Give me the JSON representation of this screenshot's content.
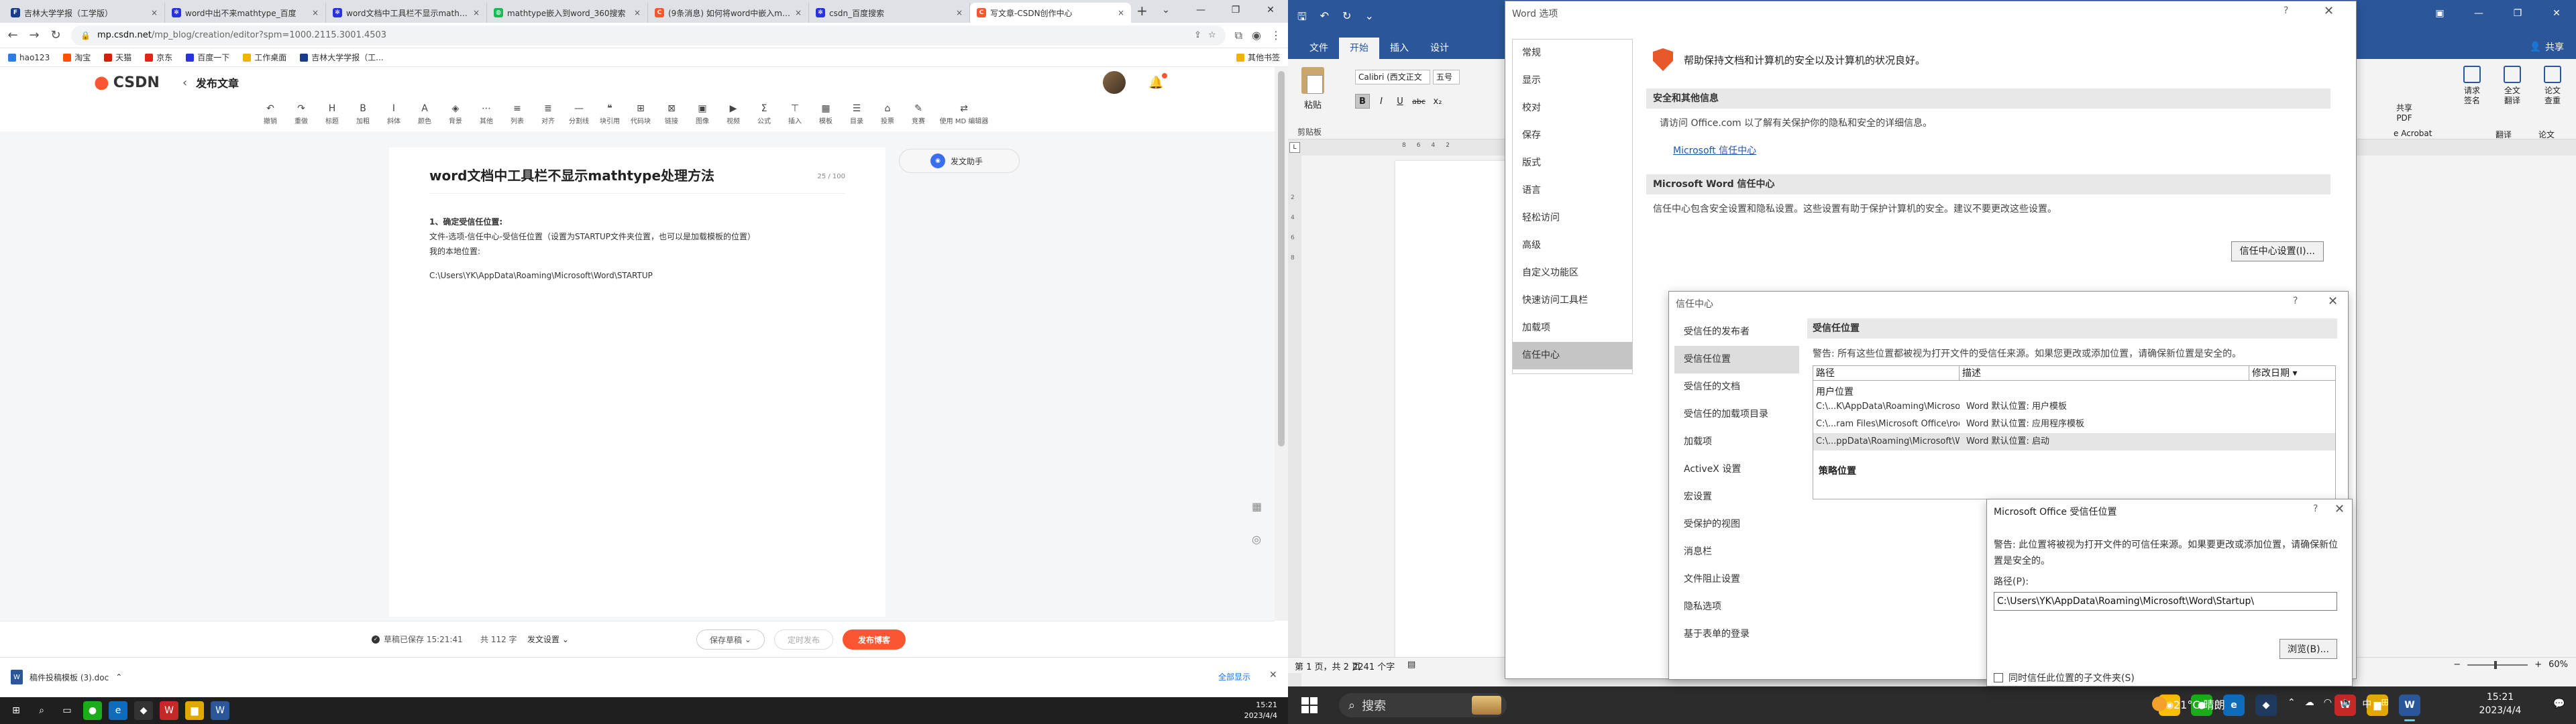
{
  "browser": {
    "tabs": [
      {
        "title": "吉林大学学报（工学版）",
        "color": "#1a3b8c",
        "glyph": "F"
      },
      {
        "title": "word中出不来mathtype_百度",
        "color": "#2932e1",
        "glyph": "✻"
      },
      {
        "title": "word文档中工具栏不显示mathtype",
        "color": "#2932e1",
        "glyph": "✻"
      },
      {
        "title": "mathtype嵌入到word_360搜索",
        "color": "#19b955",
        "glyph": "◍"
      },
      {
        "title": "(9条消息) 如何将word中嵌入mathtype",
        "color": "#fc5531",
        "glyph": "C"
      },
      {
        "title": "csdn_百度搜索",
        "color": "#2932e1",
        "glyph": "✻"
      },
      {
        "title": "写文章-CSDN创作中心",
        "color": "#fc5531",
        "glyph": "C"
      }
    ],
    "new_tab": "+",
    "url_host": "mp.csdn.net",
    "url_path": "/mp_blog/creation/editor?spm=1000.2115.3001.4503",
    "bookmarks": [
      "hao123",
      "淘宝",
      "天猫",
      "京东",
      "百度一下",
      "工作桌面",
      "吉林大学学报（工..."
    ],
    "other_bookmarks": "其他书签"
  },
  "csdn": {
    "logo": "CSDN",
    "header_title": "发布文章",
    "toolbar": [
      {
        "icon": "↶",
        "label": "撤销"
      },
      {
        "icon": "↷",
        "label": "重做"
      },
      {
        "icon": "H",
        "label": "标题"
      },
      {
        "icon": "B",
        "label": "加粗"
      },
      {
        "icon": "I",
        "label": "斜体"
      },
      {
        "icon": "A",
        "label": "颜色"
      },
      {
        "icon": "◈",
        "label": "背景"
      },
      {
        "icon": "⋯",
        "label": "其他"
      },
      {
        "icon": "≡",
        "label": "列表"
      },
      {
        "icon": "≣",
        "label": "对齐"
      },
      {
        "icon": "—",
        "label": "分割线"
      },
      {
        "icon": "❝",
        "label": "块引用"
      },
      {
        "icon": "⊞",
        "label": "代码块"
      },
      {
        "icon": "⊠",
        "label": "链接"
      },
      {
        "icon": "▣",
        "label": "图像"
      },
      {
        "icon": "▶",
        "label": "视频"
      },
      {
        "icon": "Σ",
        "label": "公式"
      },
      {
        "icon": "⊤",
        "label": "插入"
      },
      {
        "icon": "▦",
        "label": "模板"
      },
      {
        "icon": "☰",
        "label": "目录"
      },
      {
        "icon": "⌂",
        "label": "投票"
      },
      {
        "icon": "✎",
        "label": "竞赛"
      },
      {
        "icon": "⇄",
        "label": "使用 MD 编辑器"
      }
    ],
    "doc_title": "word文档中工具栏不显示mathtype处理方法",
    "word_count": "25 / 100",
    "body_heading": "1、确定受信任位置:",
    "body_line1": "文件-选项-信任中心-受信任位置（设置为STARTUP文件夹位置，也可以是加载模板的位置）",
    "body_line2": "我的本地位置:",
    "body_path": "C:\\Users\\YK\\AppData\\Roaming\\Microsoft\\Word\\STARTUP",
    "assistant_label": "发文助手",
    "draft_status": "草稿已保存 15:21:41",
    "total_words": "共 112 字",
    "article_settings": "发文设置",
    "save_draft": "保存草稿",
    "timed_publish": "定时发布",
    "publish": "发布博客"
  },
  "download": {
    "file": "稿件投稿模板 (3).doc",
    "show_all": "全部显示"
  },
  "left_taskbar": {
    "time": "15:21",
    "date": "2023/4/4"
  },
  "word": {
    "tabs": [
      "文件",
      "开始",
      "插入",
      "设计"
    ],
    "share": "共享",
    "paste": "粘贴",
    "clipboard": "剪贴板",
    "font": "Calibri (西文正文",
    "size": "五号",
    "fmt": [
      "B",
      "I",
      "U",
      "abc",
      "x₂"
    ],
    "acrobat_label": "共享\nPDF",
    "acrobat": "e Acrobat",
    "ribbon_right": [
      {
        "label": "请求\n签名"
      },
      {
        "label": "全文\n翻译"
      },
      {
        "label": "论文\n查重"
      }
    ],
    "ribbon_right_groups": [
      "翻译",
      "论文"
    ],
    "status_page": "第 1 页，共 2 页",
    "status_words": "2241 个字",
    "zoom": "60%"
  },
  "word_options": {
    "title": "Word 选项",
    "nav": [
      "常规",
      "显示",
      "校对",
      "保存",
      "版式",
      "语言",
      "轻松访问",
      "高级",
      "自定义功能区",
      "快速访问工具栏",
      "加载项",
      "信任中心"
    ],
    "heading": "帮助保持文档和计算机的安全以及计算机的状况良好。",
    "section1": "安全和其他信息",
    "section1_text": "请访问 Office.com 以了解有关保护你的隐私和安全的详细信息。",
    "link": "Microsoft 信任中心",
    "section2": "Microsoft Word 信任中心",
    "section2_text": "信任中心包含安全设置和隐私设置。这些设置有助于保护计算机的安全。建议不要更改这些设置。",
    "settings_btn": "信任中心设置(I)..."
  },
  "trust_center": {
    "title": "信任中心",
    "nav": [
      "受信任的发布者",
      "受信任位置",
      "受信任的文档",
      "受信任的加载项目录",
      "加载项",
      "ActiveX 设置",
      "宏设置",
      "受保护的视图",
      "消息栏",
      "文件阻止设置",
      "隐私选项",
      "基于表单的登录"
    ],
    "heading": "受信任位置",
    "warning": "警告: 所有这些位置都被视为打开文件的受信任来源。如果您更改或添加位置，请确保新位置是安全的。",
    "columns": [
      "路径",
      "描述",
      "修改日期 ▾"
    ],
    "user_group": "用户位置",
    "rows": [
      {
        "path": "C:\\...K\\AppData\\Roaming\\Microsoft\\Templates\\",
        "desc": "Word 默认位置: 用户模板"
      },
      {
        "path": "C:\\...ram Files\\Microsoft Office\\root\\Templates\\",
        "desc": "Word 默认位置: 应用程序模板"
      },
      {
        "path": "C:\\...ppData\\Roaming\\Microsoft\\Word\\Startup\\",
        "desc": "Word 默认位置: 启动"
      }
    ],
    "policy": "策略位置"
  },
  "location_dialog": {
    "title": "Microsoft Office 受信任位置",
    "warning": "警告: 此位置将被视为打开文件的可信任来源。如果要更改或添加位置，请确保新位置是安全的。",
    "path_label": "路径(P):",
    "path_value": "C:\\Users\\YK\\AppData\\Roaming\\Microsoft\\Word\\Startup\\",
    "browse": "浏览(B)...",
    "subfolders": "同时信任此位置的子文件夹(S)"
  },
  "right_taskbar": {
    "search": "搜索",
    "weather": "21°C 晴朗",
    "ime": "中",
    "time": "15:21",
    "date": "2023/4/4"
  }
}
